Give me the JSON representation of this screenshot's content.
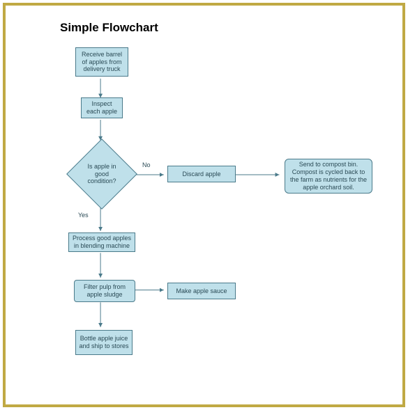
{
  "title": "Simple Flowchart",
  "nodes": {
    "receive": "Receive barrel of apples from delivery truck",
    "inspect": "Inspect each apple",
    "decision": "Is apple in good condition?",
    "discard": "Discard apple",
    "compost": "Send to compost bin. Compost is cycled back to the farm as nutrients for the apple orchard soil.",
    "process": "Process good apples in blending machine",
    "filter": "Filter pulp from apple sludge",
    "sauce": "Make apple sauce",
    "bottle": "Bottle apple juice and ship to stores"
  },
  "edgeLabels": {
    "no": "No",
    "yes": "Yes"
  },
  "colors": {
    "border": "#c0a944",
    "nodeFill": "#bfe0ea",
    "nodeStroke": "#4a7a8a"
  },
  "chart_data": {
    "type": "flowchart",
    "title": "Simple Flowchart",
    "nodes": [
      {
        "id": "receive",
        "type": "process",
        "label": "Receive barrel of apples from delivery truck"
      },
      {
        "id": "inspect",
        "type": "process",
        "label": "Inspect each apple"
      },
      {
        "id": "decision",
        "type": "decision",
        "label": "Is apple in good condition?"
      },
      {
        "id": "discard",
        "type": "process",
        "label": "Discard apple"
      },
      {
        "id": "compost",
        "type": "annotation",
        "label": "Send to compost bin. Compost is cycled back to the farm as nutrients for the apple orchard soil."
      },
      {
        "id": "process",
        "type": "process",
        "label": "Process good apples in blending machine"
      },
      {
        "id": "filter",
        "type": "process",
        "label": "Filter pulp from apple sludge"
      },
      {
        "id": "sauce",
        "type": "process",
        "label": "Make apple sauce"
      },
      {
        "id": "bottle",
        "type": "process",
        "label": "Bottle apple juice and ship to stores"
      }
    ],
    "edges": [
      {
        "from": "receive",
        "to": "inspect"
      },
      {
        "from": "inspect",
        "to": "decision"
      },
      {
        "from": "decision",
        "to": "discard",
        "label": "No"
      },
      {
        "from": "discard",
        "to": "compost"
      },
      {
        "from": "decision",
        "to": "process",
        "label": "Yes"
      },
      {
        "from": "process",
        "to": "filter"
      },
      {
        "from": "filter",
        "to": "sauce"
      },
      {
        "from": "filter",
        "to": "bottle"
      }
    ]
  }
}
